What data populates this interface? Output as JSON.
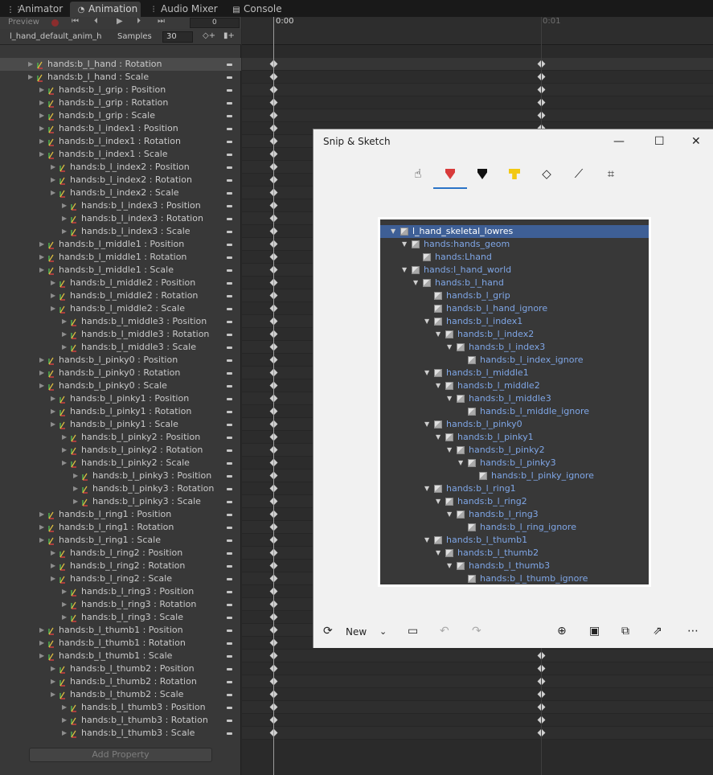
{
  "tabs": [
    {
      "label": "Animator",
      "icon": "animator-icon"
    },
    {
      "label": "Animation",
      "icon": "clock-icon"
    },
    {
      "label": "Audio Mixer",
      "icon": "mixer-icon"
    },
    {
      "label": "Console",
      "icon": "console-icon"
    }
  ],
  "toolbar": {
    "preview_label": "Preview",
    "frame_value": "0",
    "clip_name": "l_hand_default_anim_h",
    "samples_label": "Samples",
    "samples_value": "30"
  },
  "timeline": {
    "label_start": "0:00",
    "label_next": "0:01"
  },
  "properties": [
    {
      "label": "hands:b_l_hand : Rotation",
      "indent": 0,
      "selected": true
    },
    {
      "label": "hands:b_l_hand : Scale",
      "indent": 0
    },
    {
      "label": "hands:b_l_grip : Position",
      "indent": 1
    },
    {
      "label": "hands:b_l_grip : Rotation",
      "indent": 1
    },
    {
      "label": "hands:b_l_grip : Scale",
      "indent": 1
    },
    {
      "label": "hands:b_l_index1 : Position",
      "indent": 1
    },
    {
      "label": "hands:b_l_index1 : Rotation",
      "indent": 1
    },
    {
      "label": "hands:b_l_index1 : Scale",
      "indent": 1
    },
    {
      "label": "hands:b_l_index2 : Position",
      "indent": 2
    },
    {
      "label": "hands:b_l_index2 : Rotation",
      "indent": 2
    },
    {
      "label": "hands:b_l_index2 : Scale",
      "indent": 2
    },
    {
      "label": "hands:b_l_index3 : Position",
      "indent": 3
    },
    {
      "label": "hands:b_l_index3 : Rotation",
      "indent": 3
    },
    {
      "label": "hands:b_l_index3 : Scale",
      "indent": 3
    },
    {
      "label": "hands:b_l_middle1 : Position",
      "indent": 1
    },
    {
      "label": "hands:b_l_middle1 : Rotation",
      "indent": 1
    },
    {
      "label": "hands:b_l_middle1 : Scale",
      "indent": 1
    },
    {
      "label": "hands:b_l_middle2 : Position",
      "indent": 2
    },
    {
      "label": "hands:b_l_middle2 : Rotation",
      "indent": 2
    },
    {
      "label": "hands:b_l_middle2 : Scale",
      "indent": 2
    },
    {
      "label": "hands:b_l_middle3 : Position",
      "indent": 3
    },
    {
      "label": "hands:b_l_middle3 : Rotation",
      "indent": 3
    },
    {
      "label": "hands:b_l_middle3 : Scale",
      "indent": 3
    },
    {
      "label": "hands:b_l_pinky0 : Position",
      "indent": 1
    },
    {
      "label": "hands:b_l_pinky0 : Rotation",
      "indent": 1
    },
    {
      "label": "hands:b_l_pinky0 : Scale",
      "indent": 1
    },
    {
      "label": "hands:b_l_pinky1 : Position",
      "indent": 2
    },
    {
      "label": "hands:b_l_pinky1 : Rotation",
      "indent": 2
    },
    {
      "label": "hands:b_l_pinky1 : Scale",
      "indent": 2
    },
    {
      "label": "hands:b_l_pinky2 : Position",
      "indent": 3
    },
    {
      "label": "hands:b_l_pinky2 : Rotation",
      "indent": 3
    },
    {
      "label": "hands:b_l_pinky2 : Scale",
      "indent": 3
    },
    {
      "label": "hands:b_l_pinky3 : Position",
      "indent": 4
    },
    {
      "label": "hands:b_l_pinky3 : Rotation",
      "indent": 4
    },
    {
      "label": "hands:b_l_pinky3 : Scale",
      "indent": 4
    },
    {
      "label": "hands:b_l_ring1 : Position",
      "indent": 1
    },
    {
      "label": "hands:b_l_ring1 : Rotation",
      "indent": 1
    },
    {
      "label": "hands:b_l_ring1 : Scale",
      "indent": 1
    },
    {
      "label": "hands:b_l_ring2 : Position",
      "indent": 2
    },
    {
      "label": "hands:b_l_ring2 : Rotation",
      "indent": 2
    },
    {
      "label": "hands:b_l_ring2 : Scale",
      "indent": 2
    },
    {
      "label": "hands:b_l_ring3 : Position",
      "indent": 3
    },
    {
      "label": "hands:b_l_ring3 : Rotation",
      "indent": 3
    },
    {
      "label": "hands:b_l_ring3 : Scale",
      "indent": 3
    },
    {
      "label": "hands:b_l_thumb1 : Position",
      "indent": 1
    },
    {
      "label": "hands:b_l_thumb1 : Rotation",
      "indent": 1
    },
    {
      "label": "hands:b_l_thumb1 : Scale",
      "indent": 1
    },
    {
      "label": "hands:b_l_thumb2 : Position",
      "indent": 2
    },
    {
      "label": "hands:b_l_thumb2 : Rotation",
      "indent": 2
    },
    {
      "label": "hands:b_l_thumb2 : Scale",
      "indent": 2
    },
    {
      "label": "hands:b_l_thumb3 : Position",
      "indent": 3
    },
    {
      "label": "hands:b_l_thumb3 : Rotation",
      "indent": 3
    },
    {
      "label": "hands:b_l_thumb3 : Scale",
      "indent": 3
    }
  ],
  "add_property_label": "Add Property",
  "snip": {
    "title": "Snip & Sketch",
    "new_label": "New",
    "tools": [
      "touch-writing-icon",
      "ballpoint-pen-icon",
      "pencil-icon",
      "highlighter-icon",
      "eraser-icon",
      "ruler-icon",
      "crop-icon"
    ],
    "hierarchy": [
      {
        "label": "l_hand_skeletal_lowres",
        "depth": 0,
        "arrow": true,
        "selected": true
      },
      {
        "label": "hands:hands_geom",
        "depth": 1,
        "arrow": true
      },
      {
        "label": "hands:Lhand",
        "depth": 2,
        "arrow": false
      },
      {
        "label": "hands:l_hand_world",
        "depth": 1,
        "arrow": true
      },
      {
        "label": "hands:b_l_hand",
        "depth": 2,
        "arrow": true
      },
      {
        "label": "hands:b_l_grip",
        "depth": 3,
        "arrow": false
      },
      {
        "label": "hands:b_l_hand_ignore",
        "depth": 3,
        "arrow": false
      },
      {
        "label": "hands:b_l_index1",
        "depth": 3,
        "arrow": true
      },
      {
        "label": "hands:b_l_index2",
        "depth": 4,
        "arrow": true
      },
      {
        "label": "hands:b_l_index3",
        "depth": 5,
        "arrow": true
      },
      {
        "label": "hands:b_l_index_ignore",
        "depth": 6,
        "arrow": false
      },
      {
        "label": "hands:b_l_middle1",
        "depth": 3,
        "arrow": true
      },
      {
        "label": "hands:b_l_middle2",
        "depth": 4,
        "arrow": true
      },
      {
        "label": "hands:b_l_middle3",
        "depth": 5,
        "arrow": true
      },
      {
        "label": "hands:b_l_middle_ignore",
        "depth": 6,
        "arrow": false
      },
      {
        "label": "hands:b_l_pinky0",
        "depth": 3,
        "arrow": true
      },
      {
        "label": "hands:b_l_pinky1",
        "depth": 4,
        "arrow": true
      },
      {
        "label": "hands:b_l_pinky2",
        "depth": 5,
        "arrow": true
      },
      {
        "label": "hands:b_l_pinky3",
        "depth": 6,
        "arrow": true
      },
      {
        "label": "hands:b_l_pinky_ignore",
        "depth": 7,
        "arrow": false
      },
      {
        "label": "hands:b_l_ring1",
        "depth": 3,
        "arrow": true
      },
      {
        "label": "hands:b_l_ring2",
        "depth": 4,
        "arrow": true
      },
      {
        "label": "hands:b_l_ring3",
        "depth": 5,
        "arrow": true
      },
      {
        "label": "hands:b_l_ring_ignore",
        "depth": 6,
        "arrow": false
      },
      {
        "label": "hands:b_l_thumb1",
        "depth": 3,
        "arrow": true
      },
      {
        "label": "hands:b_l_thumb2",
        "depth": 4,
        "arrow": true
      },
      {
        "label": "hands:b_l_thumb3",
        "depth": 5,
        "arrow": true
      },
      {
        "label": "hands:b_l_thumb_ignore",
        "depth": 6,
        "arrow": false
      }
    ]
  },
  "colors": {
    "selection_blue": "#3e5f96",
    "link_blue": "#7fa6e6",
    "accent_underline": "#2b74c7"
  }
}
